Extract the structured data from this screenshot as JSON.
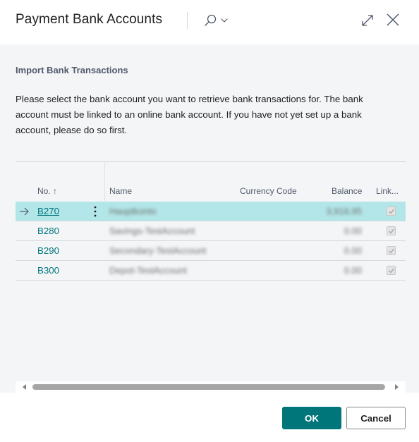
{
  "dialog": {
    "title": "Payment Bank Accounts"
  },
  "section": {
    "title": "Import Bank Transactions",
    "instruction": "Please select the bank account you want to retrieve bank transactions for. The bank account must be linked to an online bank account. If you have not yet set up a bank account, please do so first."
  },
  "grid": {
    "headers": {
      "no": "No. ↑",
      "name": "Name",
      "currency_code": "Currency Code",
      "balance": "Balance",
      "linked": "Link..."
    },
    "rows": [
      {
        "no": "B270",
        "name": "Hauptkonto",
        "currency_code": "",
        "balance": "3,916.95",
        "linked": true,
        "selected": true
      },
      {
        "no": "B280",
        "name": "Savings-TestAccount",
        "currency_code": "",
        "balance": "0.00",
        "linked": true,
        "selected": false
      },
      {
        "no": "B290",
        "name": "Secondary-TestAccount",
        "currency_code": "",
        "balance": "0.00",
        "linked": true,
        "selected": false
      },
      {
        "no": "B300",
        "name": "Depot-TestAccount",
        "currency_code": "",
        "balance": "0.00",
        "linked": true,
        "selected": false
      }
    ]
  },
  "footer": {
    "ok_label": "OK",
    "cancel_label": "Cancel"
  },
  "icons": {
    "search": "search-icon",
    "chevron": "chevron-down-icon",
    "expand": "expand-icon",
    "close": "close-icon",
    "row_arrow": "arrow-right-icon",
    "row_menu": "more-vertical-icon"
  },
  "colors": {
    "accent": "#00767b",
    "selected_row": "#b3e6e8",
    "content_bg": "#f4f5f7"
  }
}
